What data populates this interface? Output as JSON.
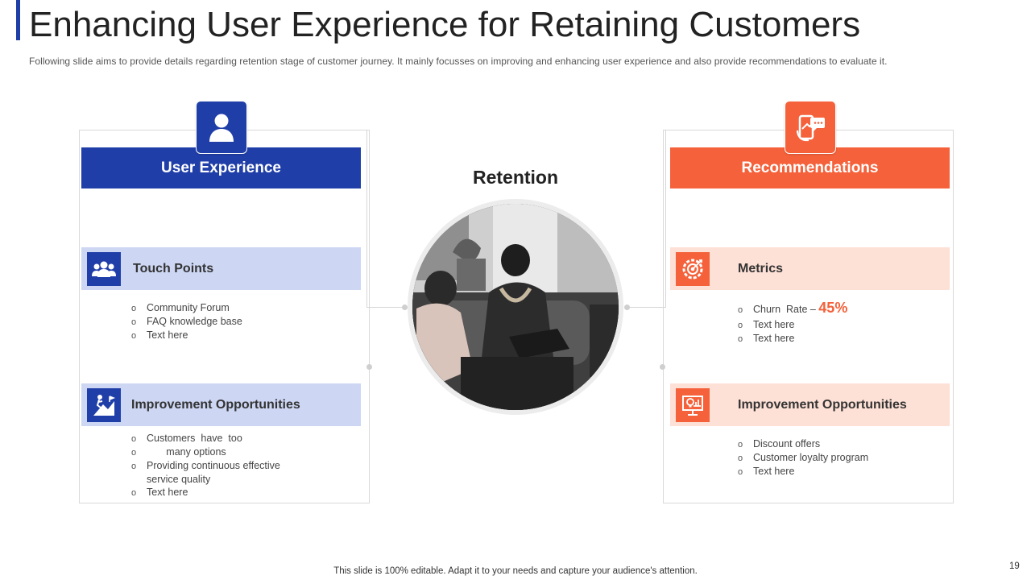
{
  "title": "Enhancing User Experience for Retaining Customers",
  "subtitle": "Following slide aims to provide  details regarding  retention  stage of customer journey.  It mainly focusses on improving  and enhancing user experience and also provide  recommendations  to evaluate  it.",
  "center": {
    "label": "Retention"
  },
  "left": {
    "header": "User Experience",
    "icon": "user-icon",
    "sections": [
      {
        "label": "Touch Points",
        "icon": "group-icon",
        "items": [
          "Community Forum",
          "FAQ knowledge  base",
          "Text here"
        ]
      },
      {
        "label": "Improvement Opportunities",
        "icon": "climb-icon",
        "items": [
          "Customers  have  too",
          "       many options",
          "Providing  continuous effective",
          "Text here"
        ],
        "continuation": "service  quality"
      }
    ]
  },
  "right": {
    "header": "Recommendations",
    "icon": "phone-chat-icon",
    "sections": [
      {
        "label": "Metrics",
        "icon": "gear-target-icon",
        "churn_label": "Churn  Rate – ",
        "churn_value": "45%",
        "items": [
          "Text here",
          "Text here"
        ]
      },
      {
        "label": "Improvement Opportunities",
        "icon": "idea-presentation-icon",
        "items": [
          "Discount offers",
          "Customer loyalty program",
          "Text here"
        ]
      }
    ]
  },
  "bullet": "o",
  "colors": {
    "blue": "#1f3ea8",
    "orange": "#f4613a",
    "light_blue": "#cdd7f4",
    "light_orange": "#fde0d6"
  },
  "footer": "This slide is 100% editable. Adapt it to your needs and capture your audience's attention.",
  "page_number": "19"
}
